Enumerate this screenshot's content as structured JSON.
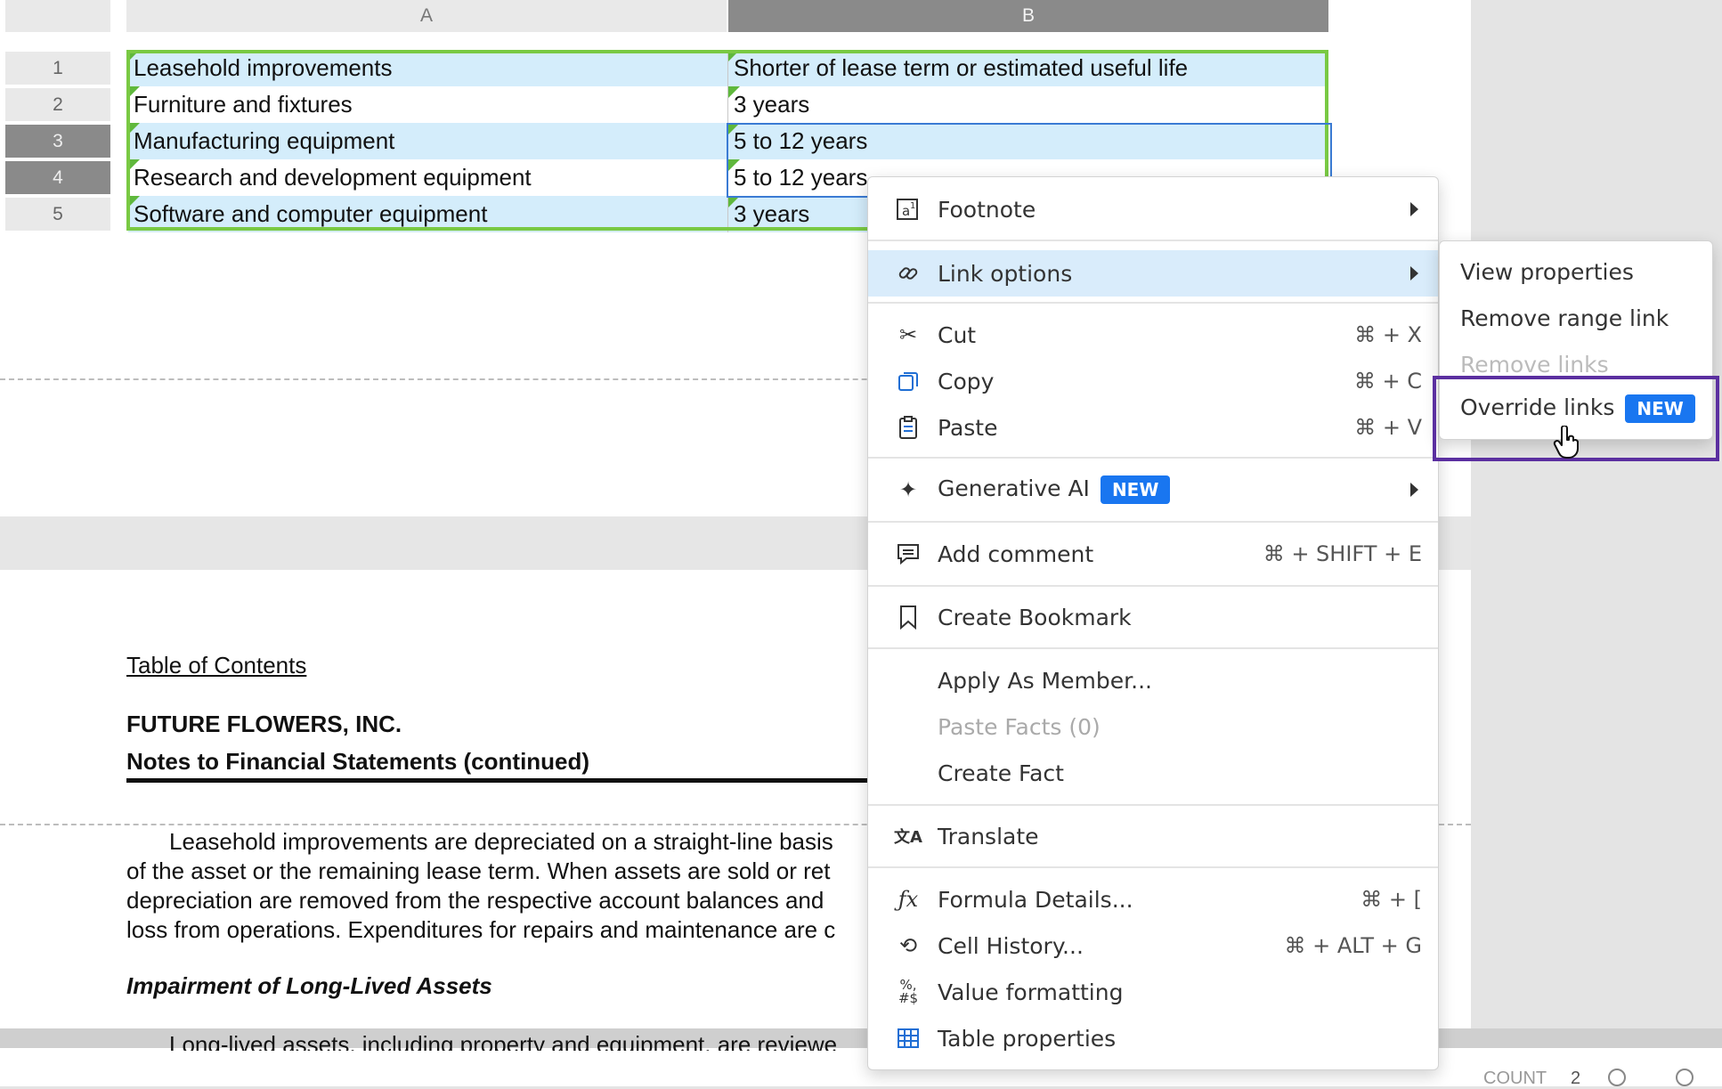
{
  "grid": {
    "columns": [
      "A",
      "B"
    ],
    "rows": [
      {
        "num": "1",
        "a": "Leasehold improvements",
        "b": "Shorter of lease term or estimated useful life"
      },
      {
        "num": "2",
        "a": "Furniture and fixtures",
        "b": "3 years"
      },
      {
        "num": "3",
        "a": "Manufacturing equipment",
        "b": "5 to 12 years"
      },
      {
        "num": "4",
        "a": "Research and development equipment",
        "b": "5 to 12 years"
      },
      {
        "num": "5",
        "a": "Software and computer equipment",
        "b": "3 years"
      }
    ]
  },
  "doc": {
    "toc": "Table of Contents",
    "company": "FUTURE FLOWERS, INC.",
    "notes": "Notes to Financial Statements (continued)",
    "para_lines": [
      "Leasehold improvements are depreciated on a straight-line basis",
      "of the asset or the remaining lease term. When assets are sold or ret",
      "depreciation are removed from the respective account balances and",
      "loss from operations. Expenditures for repairs and maintenance are c"
    ],
    "impairment_heading": "Impairment of Long-Lived Assets",
    "cut_line": "Long-lived assets, including property and equipment, are reviewe"
  },
  "menu": {
    "footnote": "Footnote",
    "link_options": "Link options",
    "cut": {
      "label": "Cut",
      "shortcut": "⌘ + X"
    },
    "copy": {
      "label": "Copy",
      "shortcut": "⌘ + C"
    },
    "paste": {
      "label": "Paste",
      "shortcut": "⌘ + V"
    },
    "generative_ai": "Generative AI",
    "new_badge": "NEW",
    "add_comment": {
      "label": "Add comment",
      "shortcut": "⌘ + SHIFT + E"
    },
    "create_bookmark": "Create Bookmark",
    "apply_as_member": "Apply As Member...",
    "paste_facts": "Paste Facts (0)",
    "create_fact": "Create Fact",
    "translate": "Translate",
    "formula_details": {
      "label": "Formula Details...",
      "shortcut": "⌘ + ["
    },
    "cell_history": {
      "label": "Cell History...",
      "shortcut": "⌘ + ALT + G"
    },
    "value_formatting": "Value formatting",
    "table_properties": "Table properties"
  },
  "submenu": {
    "view_properties": "View properties",
    "remove_range_link": "Remove range link",
    "remove_links": "Remove links",
    "override_links": "Override links",
    "new_badge": "NEW"
  },
  "status": {
    "count_label": "COUNT",
    "count_value": "2"
  },
  "colors": {
    "highlight_box": "#5b2fa0",
    "table_border": "#79c943",
    "badge": "#1976f0",
    "cell_shade": "#d4edfb"
  }
}
